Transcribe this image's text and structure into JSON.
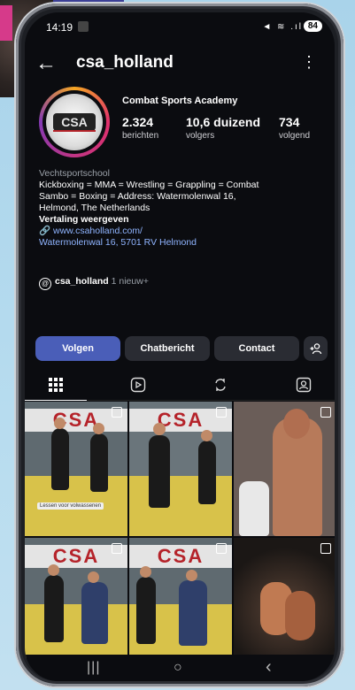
{
  "status": {
    "time": "14:19",
    "icons": "◄ ≋ .ıl",
    "battery": "84"
  },
  "topbar": {
    "username": "csa_holland",
    "back": "←",
    "more": "⋮"
  },
  "profile": {
    "full_name": "Combat Sports Academy",
    "avatar_text": "CSA",
    "stats": [
      {
        "value": "2.324",
        "label": "berichten"
      },
      {
        "value": "10,6 duizend",
        "label": "volgers"
      },
      {
        "value": "734",
        "label": "volgend"
      }
    ]
  },
  "bio": {
    "category": "Vechtsportschool",
    "line1": "Kickboxing = MMA = Wrestling = Grappling = Combat",
    "line2": "Sambo = Boxing = Address: Watermolenwal 16,",
    "line3": "Helmond, The Netherlands",
    "translate": "Vertaling weergeven",
    "link": "www.csaholland.com/",
    "address": "Watermolenwal 16, 5701 RV Helmond"
  },
  "threads": {
    "handle": "csa_holland",
    "new": "1 nieuw",
    "plus": "+"
  },
  "buttons": {
    "follow": "Volgen",
    "message": "Chatbericht",
    "contact": "Contact"
  },
  "grid": {
    "caption": "Lessen voor volwassenen",
    "banner": "CSA"
  },
  "navbar": {
    "recent": "|||",
    "home": "○",
    "back": "‹"
  },
  "colors": {
    "primary": "#4a5eb8",
    "background": "#0b0c10",
    "link": "#8fb4ff"
  }
}
